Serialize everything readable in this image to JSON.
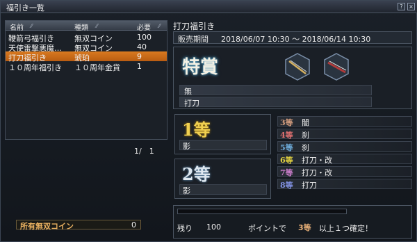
{
  "window": {
    "title": "福引き一覧",
    "help_label": "?",
    "close_label": "×"
  },
  "list": {
    "headers": [
      "名前",
      "種類",
      "必要"
    ],
    "rows": [
      {
        "name": "鞭箭弓福引き",
        "type": "無双コイン",
        "need": "100",
        "selected": false
      },
      {
        "name": "天使雷撃悪魔…",
        "type": "無双コイン",
        "need": "40",
        "selected": false
      },
      {
        "name": "打刀福引き",
        "type": "琥珀",
        "need": "9",
        "selected": true
      },
      {
        "name": "１０周年福引き",
        "type": "１０周年金貨",
        "need": "1",
        "selected": false
      }
    ],
    "pager": "1/　1"
  },
  "owned": {
    "label": "所有無双コイン",
    "value": "0"
  },
  "detail": {
    "title": "打刀福引き",
    "period_label": "販売期間",
    "period_value": "2018/06/07 10:30 〜 2018/06/14 10:30",
    "grand_title": "特賞",
    "grand_lines": [
      "無",
      "打刀"
    ],
    "rank1_title": "1等",
    "rank1_item": "影",
    "rank2_title": "2等",
    "rank2_item": "影",
    "prizes": [
      {
        "rank": "3",
        "suffix": "等",
        "item": "闇",
        "color": "#d9a080"
      },
      {
        "rank": "4",
        "suffix": "等",
        "item": "刹",
        "color": "#e07070"
      },
      {
        "rank": "5",
        "suffix": "等",
        "item": "刹",
        "color": "#70b0e0"
      },
      {
        "rank": "6",
        "suffix": "等",
        "item": "打刀・改",
        "color": "#e0d040"
      },
      {
        "rank": "7",
        "suffix": "等",
        "item": "打刀・改",
        "color": "#d080d0"
      },
      {
        "rank": "8",
        "suffix": "等",
        "item": "打刀",
        "color": "#8090e0"
      }
    ],
    "remaining_label": "残り",
    "remaining_value": "100",
    "progress": 0.0,
    "guarantee_prefix": "ポイントで",
    "guarantee_rank": "3等",
    "guarantee_suffix": "以上１つ確定！"
  },
  "icons": [
    "sort-icon",
    "katana-icon",
    "katana-sheathed-icon"
  ]
}
